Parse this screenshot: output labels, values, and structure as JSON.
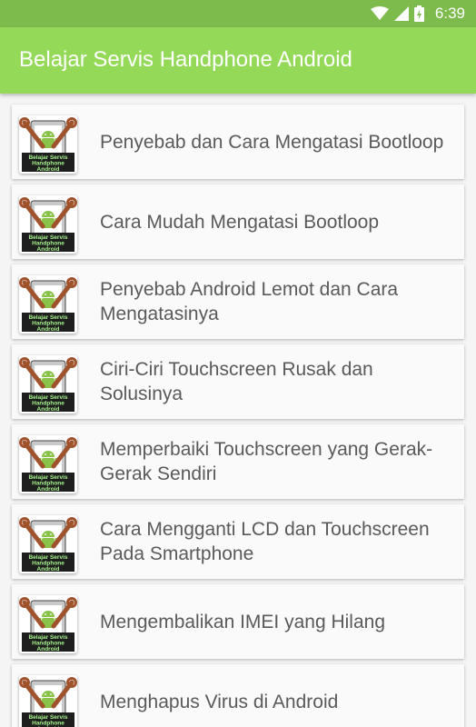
{
  "status_bar": {
    "time": "6:39",
    "icons": [
      "wifi-icon",
      "signal-icon",
      "battery-icon"
    ]
  },
  "app_bar": {
    "title": "Belajar Servis Handphone Android",
    "color": "#95d959"
  },
  "thumbnail": {
    "line1": "Belajar Servis",
    "line2": "Handphone",
    "line3": "Android"
  },
  "articles": [
    {
      "title": "Penyebab dan Cara Mengatasi Bootloop"
    },
    {
      "title": "Cara Mudah Mengatasi Bootloop"
    },
    {
      "title": "Penyebab Android Lemot dan Cara Mengatasinya"
    },
    {
      "title": "Ciri-Ciri Touchscreen Rusak dan Solusinya"
    },
    {
      "title": "Memperbaiki Touchscreen yang Gerak-Gerak Sendiri"
    },
    {
      "title": "Cara Mengganti LCD dan Touchscreen Pada Smartphone"
    },
    {
      "title": "Mengembalikan IMEI yang Hilang"
    },
    {
      "title": "Menghapus Virus di Android"
    }
  ]
}
